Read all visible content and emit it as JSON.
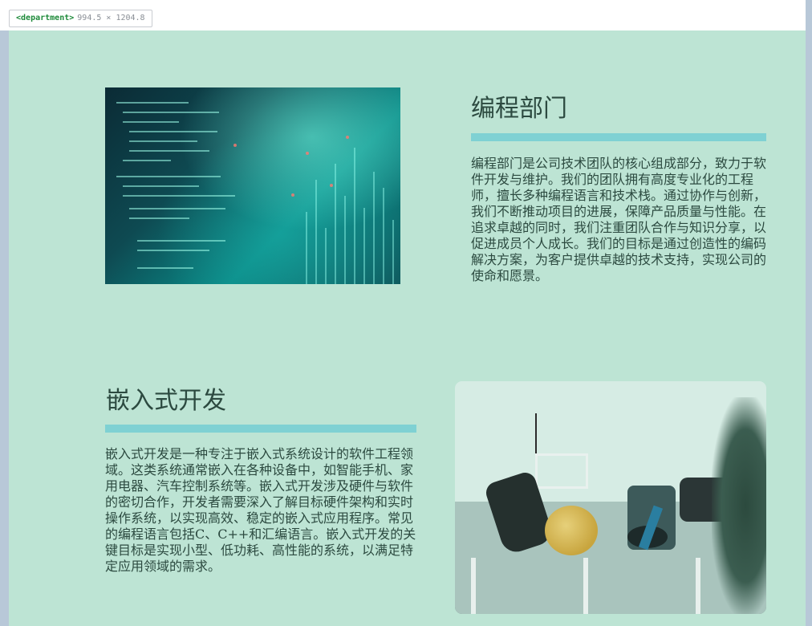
{
  "devtools": {
    "element_tag": "department",
    "dimensions": "994.5 × 1204.8"
  },
  "sections": [
    {
      "title": "编程部门",
      "text": "编程部门是公司技术团队的核心组成部分，致力于软件开发与维护。我们的团队拥有高度专业化的工程师，擅长多种编程语言和技术栈。通过协作与创新，我们不断推动项目的进展，保障产品质量与性能。在追求卓越的同时，我们注重团队合作与知识分享，以促进成员个人成长。我们的目标是通过创造性的编码解决方案，为客户提供卓越的技术支持，实现公司的使命和愿景。",
      "image": "code-screen-image"
    },
    {
      "title": "嵌入式开发",
      "text": "嵌入式开发是一种专注于嵌入式系统设计的软件工程领域。这类系统通常嵌入在各种设备中，如智能手机、家用电器、汽车控制系统等。嵌入式开发涉及硬件与软件的密切合作，开发者需要深入了解目标硬件架构和实时操作系统，以实现高效、稳定的嵌入式应用程序。常见的编程语言包括C、C++和汇编语言。嵌入式开发的关键目标是实现小型、低功耗、高性能的系统，以满足特定应用领域的需求。",
      "image": "robotics-lab-image"
    }
  ],
  "colors": {
    "page_background": "#bde4d4",
    "accent_rule": "#7fd1d3",
    "text": "#2c4a40"
  }
}
